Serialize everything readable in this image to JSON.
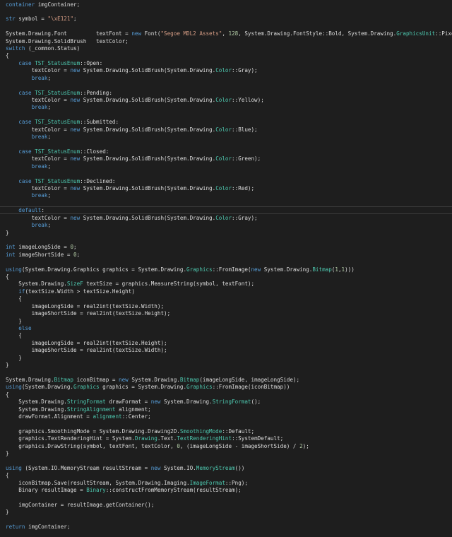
{
  "editor": {
    "lines": [
      [
        [
          "kw",
          "container"
        ],
        [
          "tx",
          " imgContainer;"
        ]
      ],
      [],
      [
        [
          "kw",
          "str"
        ],
        [
          "tx",
          " symbol = "
        ],
        [
          "st",
          "\"\\xE121\""
        ],
        [
          "tx",
          ";"
        ]
      ],
      [],
      [
        [
          "tx",
          "System.Drawing.Font         textFont = "
        ],
        [
          "kw",
          "new"
        ],
        [
          "tx",
          " Font("
        ],
        [
          "st",
          "\"Segoe MDL2 Assets\""
        ],
        [
          "tx",
          ", "
        ],
        [
          "nm",
          "128"
        ],
        [
          "tx",
          ", System.Drawing.FontStyle::Bold, System.Drawing."
        ],
        [
          "ty",
          "GraphicsUnit"
        ],
        [
          "tx",
          "::Pixel);"
        ]
      ],
      [
        [
          "tx",
          "System.Drawing.SolidBrush   textColor;"
        ]
      ],
      [
        [
          "kw",
          "switch"
        ],
        [
          "tx",
          " (_common.Status)"
        ]
      ],
      [
        [
          "tx",
          "{"
        ]
      ],
      [
        [
          "tx",
          "    "
        ],
        [
          "kw",
          "case"
        ],
        [
          "tx",
          " "
        ],
        [
          "ty",
          "TST_StatusEnum"
        ],
        [
          "tx",
          "::Open:"
        ]
      ],
      [
        [
          "tx",
          "        textColor = "
        ],
        [
          "kw",
          "new"
        ],
        [
          "tx",
          " System.Drawing.SolidBrush(System.Drawing."
        ],
        [
          "ty",
          "Color"
        ],
        [
          "tx",
          "::Gray);"
        ]
      ],
      [
        [
          "tx",
          "        "
        ],
        [
          "kw",
          "break"
        ],
        [
          "tx",
          ";"
        ]
      ],
      [],
      [
        [
          "tx",
          "    "
        ],
        [
          "kw",
          "case"
        ],
        [
          "tx",
          " "
        ],
        [
          "ty",
          "TST_StatusEnum"
        ],
        [
          "tx",
          "::Pending:"
        ]
      ],
      [
        [
          "tx",
          "        textColor = "
        ],
        [
          "kw",
          "new"
        ],
        [
          "tx",
          " System.Drawing.SolidBrush(System.Drawing."
        ],
        [
          "ty",
          "Color"
        ],
        [
          "tx",
          "::Yellow);"
        ]
      ],
      [
        [
          "tx",
          "        "
        ],
        [
          "kw",
          "break"
        ],
        [
          "tx",
          ";"
        ]
      ],
      [],
      [
        [
          "tx",
          "    "
        ],
        [
          "kw",
          "case"
        ],
        [
          "tx",
          " "
        ],
        [
          "ty",
          "TST_StatusEnum"
        ],
        [
          "tx",
          "::Submitted:"
        ]
      ],
      [
        [
          "tx",
          "        textColor = "
        ],
        [
          "kw",
          "new"
        ],
        [
          "tx",
          " System.Drawing.SolidBrush(System.Drawing."
        ],
        [
          "ty",
          "Color"
        ],
        [
          "tx",
          "::Blue);"
        ]
      ],
      [
        [
          "tx",
          "        "
        ],
        [
          "kw",
          "break"
        ],
        [
          "tx",
          ";"
        ]
      ],
      [],
      [
        [
          "tx",
          "    "
        ],
        [
          "kw",
          "case"
        ],
        [
          "tx",
          " "
        ],
        [
          "ty",
          "TST_StatusEnum"
        ],
        [
          "tx",
          "::Closed:"
        ]
      ],
      [
        [
          "tx",
          "        textColor = "
        ],
        [
          "kw",
          "new"
        ],
        [
          "tx",
          " System.Drawing.SolidBrush(System.Drawing."
        ],
        [
          "ty",
          "Color"
        ],
        [
          "tx",
          "::Green);"
        ]
      ],
      [
        [
          "tx",
          "        "
        ],
        [
          "kw",
          "break"
        ],
        [
          "tx",
          ";"
        ]
      ],
      [],
      [
        [
          "tx",
          "    "
        ],
        [
          "kw",
          "case"
        ],
        [
          "tx",
          " "
        ],
        [
          "ty",
          "TST_StatusEnum"
        ],
        [
          "tx",
          "::Declined:"
        ]
      ],
      [
        [
          "tx",
          "        textColor = "
        ],
        [
          "kw",
          "new"
        ],
        [
          "tx",
          " System.Drawing.SolidBrush(System.Drawing."
        ],
        [
          "ty",
          "Color"
        ],
        [
          "tx",
          "::Red);"
        ]
      ],
      [
        [
          "tx",
          "        "
        ],
        [
          "kw",
          "break"
        ],
        [
          "tx",
          ";"
        ]
      ],
      [],
      [
        [
          "tx",
          "    "
        ],
        [
          "kw",
          "default"
        ],
        [
          "tx",
          ":"
        ]
      ],
      [
        [
          "tx",
          "        textColor = "
        ],
        [
          "kw",
          "new"
        ],
        [
          "tx",
          " System.Drawing.SolidBrush(System.Drawing."
        ],
        [
          "ty",
          "Color"
        ],
        [
          "tx",
          "::Gray);"
        ]
      ],
      [
        [
          "tx",
          "        "
        ],
        [
          "kw",
          "break"
        ],
        [
          "tx",
          ";"
        ]
      ],
      [
        [
          "tx",
          "}"
        ]
      ],
      [],
      [
        [
          "kw",
          "int"
        ],
        [
          "tx",
          " imageLongSide = "
        ],
        [
          "nm",
          "0"
        ],
        [
          "tx",
          ";"
        ]
      ],
      [
        [
          "kw",
          "int"
        ],
        [
          "tx",
          " imageShortSide = "
        ],
        [
          "nm",
          "0"
        ],
        [
          "tx",
          ";"
        ]
      ],
      [],
      [
        [
          "kw",
          "using"
        ],
        [
          "tx",
          "(System.Drawing.Graphics graphics = System.Drawing."
        ],
        [
          "ty",
          "Graphics"
        ],
        [
          "tx",
          "::FromImage("
        ],
        [
          "kw",
          "new"
        ],
        [
          "tx",
          " System.Drawing."
        ],
        [
          "ty",
          "Bitmap"
        ],
        [
          "tx",
          "("
        ],
        [
          "nm",
          "1"
        ],
        [
          "tx",
          ","
        ],
        [
          "nm",
          "1"
        ],
        [
          "tx",
          ")))"
        ]
      ],
      [
        [
          "tx",
          "{"
        ]
      ],
      [
        [
          "tx",
          "    System.Drawing."
        ],
        [
          "ty",
          "SizeF"
        ],
        [
          "tx",
          " textSize = graphics.MeasureString(symbol, textFont);"
        ]
      ],
      [
        [
          "tx",
          "    "
        ],
        [
          "kw",
          "if"
        ],
        [
          "tx",
          "(textSize.Width > textSize.Height)"
        ]
      ],
      [
        [
          "tx",
          "    {"
        ]
      ],
      [
        [
          "tx",
          "        imageLongSide = real2int(textSize.Width);"
        ]
      ],
      [
        [
          "tx",
          "        imageShortSide = real2int(textSize.Height);"
        ]
      ],
      [
        [
          "tx",
          "    }"
        ]
      ],
      [
        [
          "tx",
          "    "
        ],
        [
          "kw",
          "else"
        ]
      ],
      [
        [
          "tx",
          "    {"
        ]
      ],
      [
        [
          "tx",
          "        imageLongSide = real2int(textSize.Height);"
        ]
      ],
      [
        [
          "tx",
          "        imageShortSide = real2int(textSize.Width);"
        ]
      ],
      [
        [
          "tx",
          "    }"
        ]
      ],
      [
        [
          "tx",
          "}"
        ]
      ],
      [],
      [
        [
          "tx",
          "System.Drawing."
        ],
        [
          "ty",
          "Bitmap"
        ],
        [
          "tx",
          " iconBitmap = "
        ],
        [
          "kw",
          "new"
        ],
        [
          "tx",
          " System.Drawing."
        ],
        [
          "ty",
          "Bitmap"
        ],
        [
          "tx",
          "(imageLongSide, imageLongSide);"
        ]
      ],
      [
        [
          "kw",
          "using"
        ],
        [
          "tx",
          "(System.Drawing."
        ],
        [
          "ty",
          "Graphics"
        ],
        [
          "tx",
          " graphics = System.Drawing."
        ],
        [
          "ty",
          "Graphics"
        ],
        [
          "tx",
          "::FromImage(iconBitmap))"
        ]
      ],
      [
        [
          "tx",
          "{"
        ]
      ],
      [
        [
          "tx",
          "    System.Drawing."
        ],
        [
          "ty",
          "StringFormat"
        ],
        [
          "tx",
          " drawFormat = "
        ],
        [
          "kw",
          "new"
        ],
        [
          "tx",
          " System.Drawing."
        ],
        [
          "ty",
          "StringFormat"
        ],
        [
          "tx",
          "();"
        ]
      ],
      [
        [
          "tx",
          "    System.Drawing."
        ],
        [
          "ty",
          "StringAlignment"
        ],
        [
          "tx",
          " alignment;"
        ]
      ],
      [
        [
          "tx",
          "    drawFormat.Alignment = "
        ],
        [
          "ty",
          "alignment"
        ],
        [
          "tx",
          "::Center;"
        ]
      ],
      [],
      [
        [
          "tx",
          "    graphics.SmoothingMode = System.Drawing.Drawing2D."
        ],
        [
          "ty",
          "SmoothingMode"
        ],
        [
          "tx",
          "::Default;"
        ]
      ],
      [
        [
          "tx",
          "    graphics.TextRenderingHint = System."
        ],
        [
          "ty",
          "Drawing"
        ],
        [
          "tx",
          ".Text."
        ],
        [
          "ty",
          "TextRenderingHint"
        ],
        [
          "tx",
          "::SystemDefault;"
        ]
      ],
      [
        [
          "tx",
          "    graphics.DrawString(symbol, textFont, textColor, "
        ],
        [
          "nm",
          "0"
        ],
        [
          "tx",
          ", (imageLongSide - imageShortSide) / "
        ],
        [
          "nm",
          "2"
        ],
        [
          "tx",
          ");"
        ]
      ],
      [
        [
          "tx",
          "}"
        ]
      ],
      [],
      [
        [
          "kw",
          "using"
        ],
        [
          "tx",
          " (System.IO.MemoryStream resultStream = "
        ],
        [
          "kw",
          "new"
        ],
        [
          "tx",
          " System.IO."
        ],
        [
          "ty",
          "MemoryStream"
        ],
        [
          "tx",
          "())"
        ]
      ],
      [
        [
          "tx",
          "{"
        ]
      ],
      [
        [
          "tx",
          "    iconBitmap.Save(resultStream, System.Drawing.Imaging."
        ],
        [
          "ty",
          "ImageFormat"
        ],
        [
          "tx",
          "::Png);"
        ]
      ],
      [
        [
          "tx",
          "    Binary resultImage = "
        ],
        [
          "ty",
          "Binary"
        ],
        [
          "tx",
          "::constructFromMemoryStream(resultStream);"
        ]
      ],
      [],
      [
        [
          "tx",
          "    imgContainer = resultImage.getContainer();"
        ]
      ],
      [
        [
          "tx",
          "}"
        ]
      ],
      [],
      [
        [
          "kw",
          "return"
        ],
        [
          "tx",
          " imgContainer;"
        ]
      ]
    ]
  }
}
